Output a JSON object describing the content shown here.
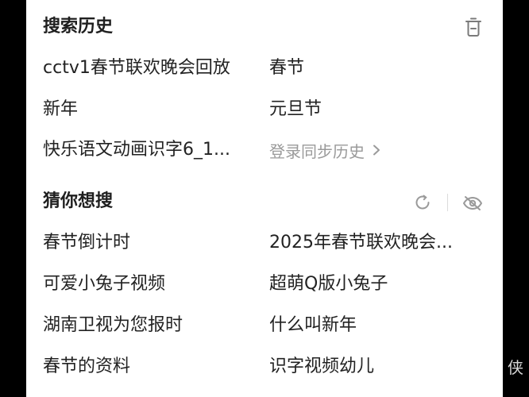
{
  "history": {
    "title": "搜索历史",
    "rows": [
      {
        "left": "cctv1春节联欢晚会回放",
        "right": "春节"
      },
      {
        "left": "新年",
        "right": "元旦节"
      },
      {
        "left": "快乐语文动画识字6_1..."
      }
    ],
    "login_sync_label": "登录同步历史"
  },
  "guess": {
    "title": "猜你想搜",
    "rows": [
      {
        "left": "春节倒计时",
        "right": "2025年春节联欢晚会..."
      },
      {
        "left": "可爱小兔子视频",
        "right": "超萌Q版小兔子"
      },
      {
        "left": "湖南卫视为您报时",
        "right": "什么叫新年"
      },
      {
        "left": "春节的资料",
        "right": "识字视频幼儿"
      }
    ]
  },
  "icons": {
    "delete": "trash-icon",
    "refresh": "refresh-icon",
    "hide": "eye-off-icon",
    "chevron": "chevron-right-icon"
  },
  "side_char": "侠"
}
